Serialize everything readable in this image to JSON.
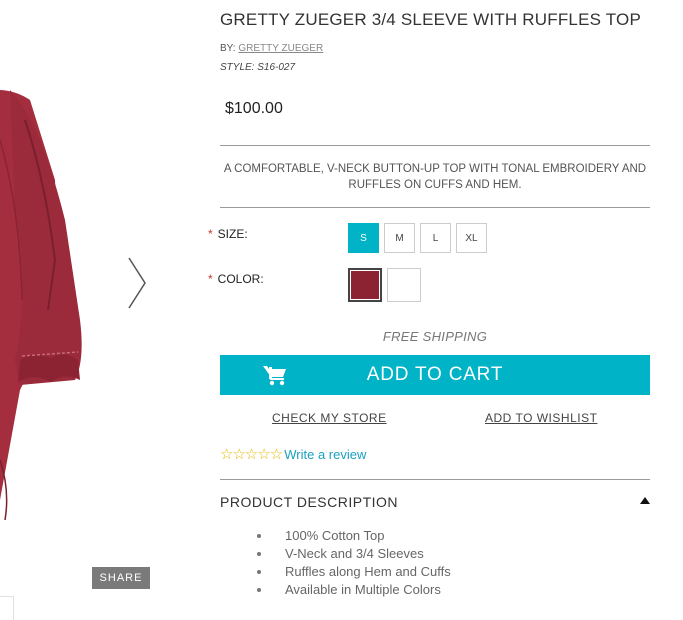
{
  "product": {
    "title": "GRETTY ZUEGER 3/4 SLEEVE WITH RUFFLES TOP",
    "by_label": "BY:",
    "brand": "GRETTY ZUEGER",
    "style_label": "STYLE: S16-027",
    "price": "$100.00",
    "summary": "A COMFORTABLE, V-NECK BUTTON-UP TOP WITH TONAL EMBROIDERY AND RUFFLES ON CUFFS AND HEM."
  },
  "options": {
    "size_label": "SIZE:",
    "color_label": "COLOR:",
    "required_mark": "*",
    "sizes": [
      "S",
      "M",
      "L",
      "XL"
    ],
    "selected_size": "S",
    "colors": [
      "#8c2333",
      "#ffffff"
    ],
    "selected_color": "#8c2333"
  },
  "shipping": "FREE SHIPPING",
  "actions": {
    "add_to_cart": "ADD TO CART",
    "check_store": "CHECK MY STORE",
    "add_to_wishlist": "ADD TO WISHLIST",
    "share": "SHARE"
  },
  "rating": {
    "stars": "☆☆☆☆☆",
    "value": 0,
    "max": 5,
    "write_review": "Write a review"
  },
  "description": {
    "heading": "PRODUCT DESCRIPTION",
    "bullets": [
      "100% Cotton Top",
      "V-Neck and 3/4 Sleeves",
      "Ruffles along Hem and Cuffs",
      "Available in Multiple Colors"
    ]
  },
  "colors": {
    "accent": "#00b3c7",
    "garment": "#9b2a3a",
    "required": "#c0392b"
  },
  "icons": {
    "next": "chevron-right-icon",
    "cart": "cart-icon",
    "collapse": "triangle-up-icon"
  }
}
